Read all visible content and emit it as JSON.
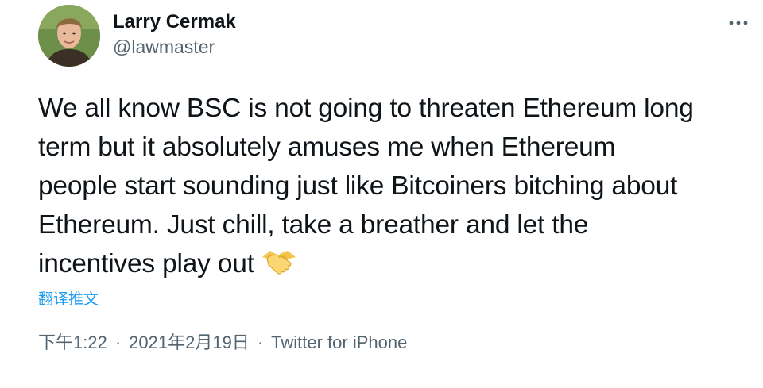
{
  "author": {
    "name": "Larry Cermak",
    "handle": "@lawmaster"
  },
  "tweet": {
    "lines": [
      "We all know BSC is not going to threaten Ethereum long",
      "term but it absolutely amuses me when Ethereum",
      "people start sounding just like Bitcoiners bitching about",
      "Ethereum. Just chill, take a breather and let the",
      "incentives play out"
    ],
    "emoji": "handshake-emoji",
    "translate_label": "翻译推文"
  },
  "meta": {
    "time": "下午1:22",
    "separator": "·",
    "date": "2021年2月19日",
    "source": "Twitter for iPhone"
  },
  "icons": {
    "more": "more-horizontal-icon"
  },
  "colors": {
    "text": "#0f1419",
    "secondary": "#536471",
    "link": "#1d9bf0",
    "divider": "#e6ecf0"
  }
}
